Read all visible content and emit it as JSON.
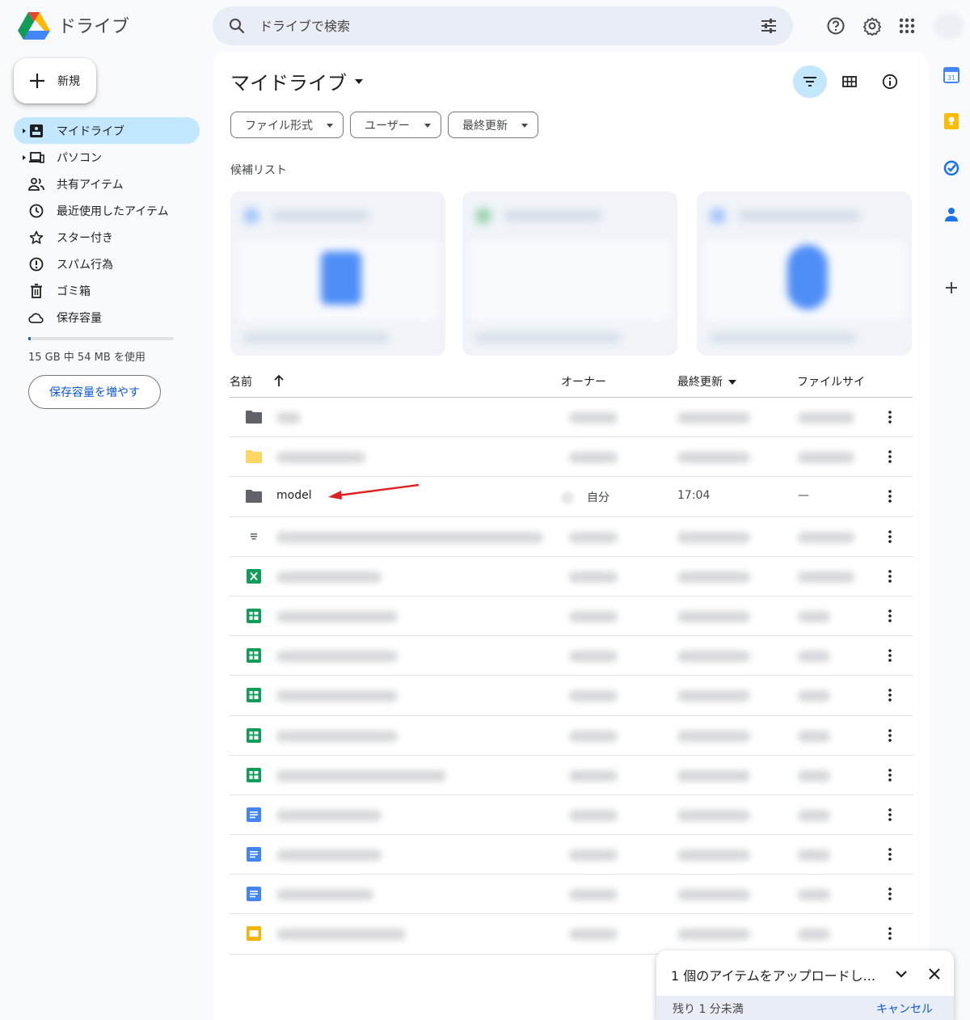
{
  "header": {
    "app_title": "ドライブ",
    "search_placeholder": "ドライブで検索",
    "icons": [
      "drive-logo-icon",
      "search-icon",
      "tune-icon",
      "help-icon",
      "settings-icon",
      "apps-grid-icon"
    ]
  },
  "new_button": {
    "label": "新規"
  },
  "sidebar": {
    "items": [
      {
        "label": "マイドライブ",
        "icon": "my-drive-icon",
        "active": true,
        "expandable": true
      },
      {
        "label": "パソコン",
        "icon": "computers-icon",
        "active": false,
        "expandable": true
      },
      {
        "label": "共有アイテム",
        "icon": "shared-icon",
        "active": false,
        "expandable": false
      },
      {
        "label": "最近使用したアイテム",
        "icon": "recent-clock-icon",
        "active": false,
        "expandable": false
      },
      {
        "label": "スター付き",
        "icon": "star-icon",
        "active": false,
        "expandable": false
      },
      {
        "label": "スパム行為",
        "icon": "spam-icon",
        "active": false,
        "expandable": false
      },
      {
        "label": "ゴミ箱",
        "icon": "trash-icon",
        "active": false,
        "expandable": false
      },
      {
        "label": "保存容量",
        "icon": "cloud-icon",
        "active": false,
        "expandable": false
      }
    ],
    "storage": {
      "usage_text": "15 GB 中 54 MB を使用",
      "used_fraction": 0.0035,
      "button_label": "保存容量を増やす"
    }
  },
  "main": {
    "title": "マイドライブ",
    "filters": [
      {
        "label": "ファイル形式"
      },
      {
        "label": "ユーザー"
      },
      {
        "label": "最終更新"
      }
    ],
    "suggested_label": "候補リスト",
    "columns": {
      "name": "名前",
      "owner": "オーナー",
      "modified": "最終更新",
      "size": "ファイルサイ"
    },
    "rows": [
      {
        "type": "folder-dark",
        "name": "",
        "owner": "",
        "modified": "",
        "size": "",
        "blurred": true
      },
      {
        "type": "folder-yellow",
        "name": "",
        "owner": "",
        "modified": "",
        "size": "",
        "blurred": true
      },
      {
        "type": "folder-dark",
        "name": "model",
        "owner": "自分",
        "modified": "17:04",
        "size": "—",
        "blurred": false
      },
      {
        "type": "text",
        "name": "",
        "owner": "",
        "modified": "",
        "size": "",
        "blurred": true
      },
      {
        "type": "excel",
        "name": "",
        "owner": "",
        "modified": "",
        "size": "",
        "blurred": true
      },
      {
        "type": "sheets",
        "name": "",
        "owner": "",
        "modified": "",
        "size": "",
        "blurred": true
      },
      {
        "type": "sheets",
        "name": "",
        "owner": "",
        "modified": "",
        "size": "",
        "blurred": true
      },
      {
        "type": "sheets",
        "name": "",
        "owner": "",
        "modified": "",
        "size": "",
        "blurred": true
      },
      {
        "type": "sheets",
        "name": "",
        "owner": "",
        "modified": "",
        "size": "",
        "blurred": true
      },
      {
        "type": "sheets",
        "name": "",
        "owner": "",
        "modified": "",
        "size": "",
        "blurred": true
      },
      {
        "type": "docs",
        "name": "",
        "owner": "",
        "modified": "",
        "size": "",
        "blurred": true
      },
      {
        "type": "docs",
        "name": "",
        "owner": "",
        "modified": "",
        "size": "",
        "blurred": true
      },
      {
        "type": "docs",
        "name": "",
        "owner": "",
        "modified": "",
        "size": "",
        "blurred": true
      },
      {
        "type": "slides",
        "name": "",
        "owner": "",
        "modified": "",
        "size": "",
        "blurred": true
      }
    ]
  },
  "right_rail": {
    "icons": [
      "calendar-icon",
      "keep-icon",
      "tasks-icon",
      "contacts-icon",
      "add-addon-icon"
    ],
    "calendar_day": "31"
  },
  "upload_panel": {
    "title": "1 個のアイテムをアップロードし...",
    "status": "残り 1 分未満",
    "cancel_label": "キャンセル"
  },
  "colors": {
    "accent": "#0b57d0",
    "active_nav": "#c2e7ff",
    "annotation_arrow": "#e02020"
  }
}
